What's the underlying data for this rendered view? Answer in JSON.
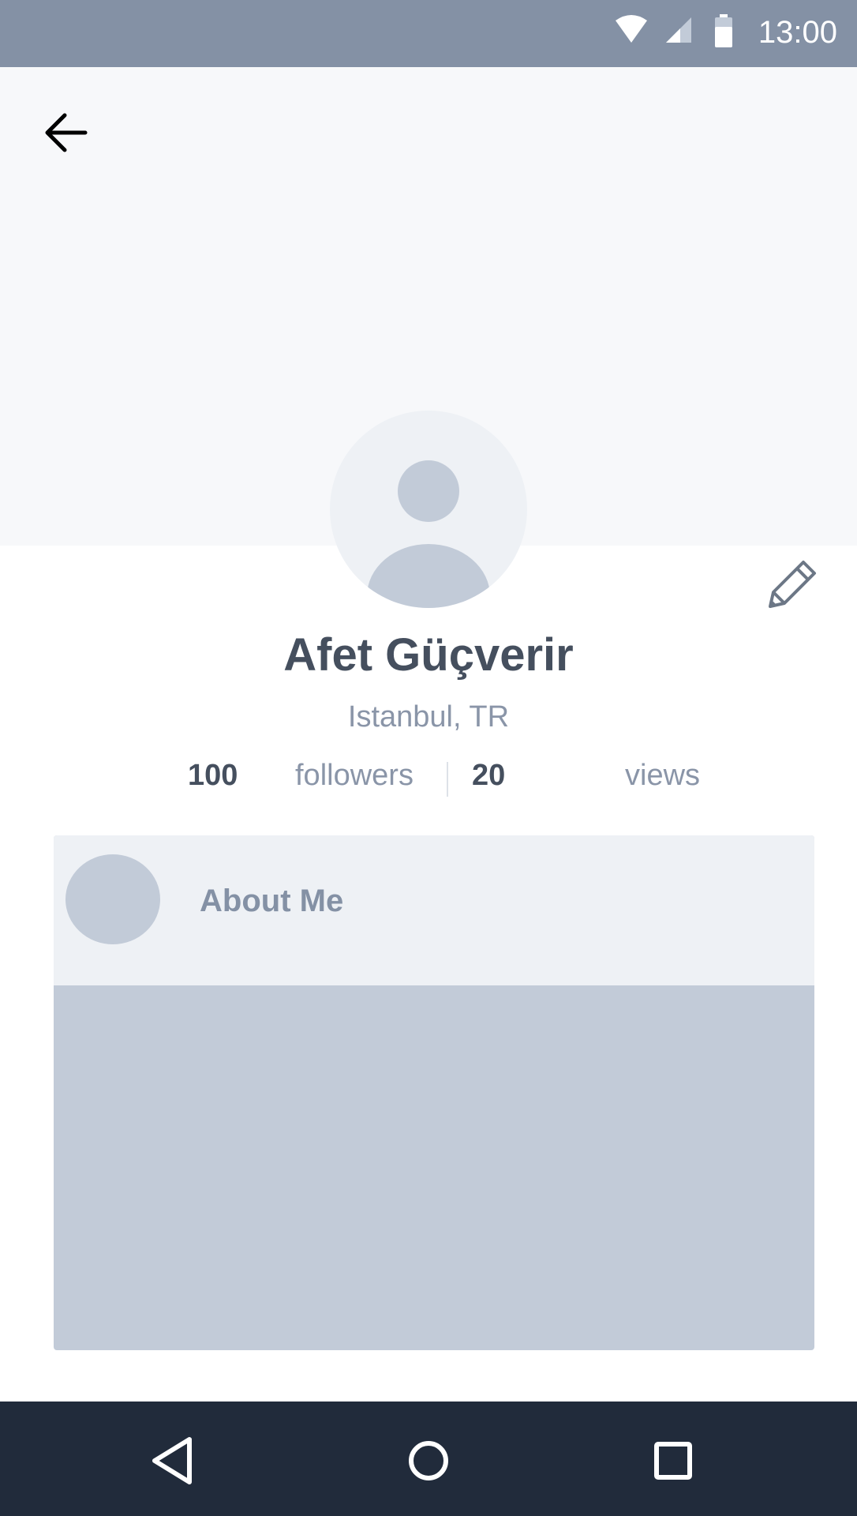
{
  "status_bar": {
    "time": "13:00",
    "icons": [
      "wifi-icon",
      "signal-icon",
      "battery-icon"
    ],
    "background": "#8491a5"
  },
  "header": {
    "back_icon": "arrow-left-icon"
  },
  "profile": {
    "avatar_icon": "user-placeholder-icon",
    "edit_icon": "pencil-icon",
    "name": "Afet Güçverir",
    "location": "Istanbul, TR",
    "stats": {
      "followers_count": "100",
      "followers_label": "followers",
      "views_count": "20",
      "views_label": "views"
    }
  },
  "about": {
    "title": "About Me"
  },
  "nav_bar": {
    "buttons": [
      "back-triangle-icon",
      "home-circle-icon",
      "recents-square-icon"
    ],
    "background": "#212b3b"
  },
  "colors": {
    "text_primary": "#454f5e",
    "text_secondary": "#8a95a8",
    "placeholder": "#c2cbd8",
    "cover": "#f7f8fa"
  }
}
